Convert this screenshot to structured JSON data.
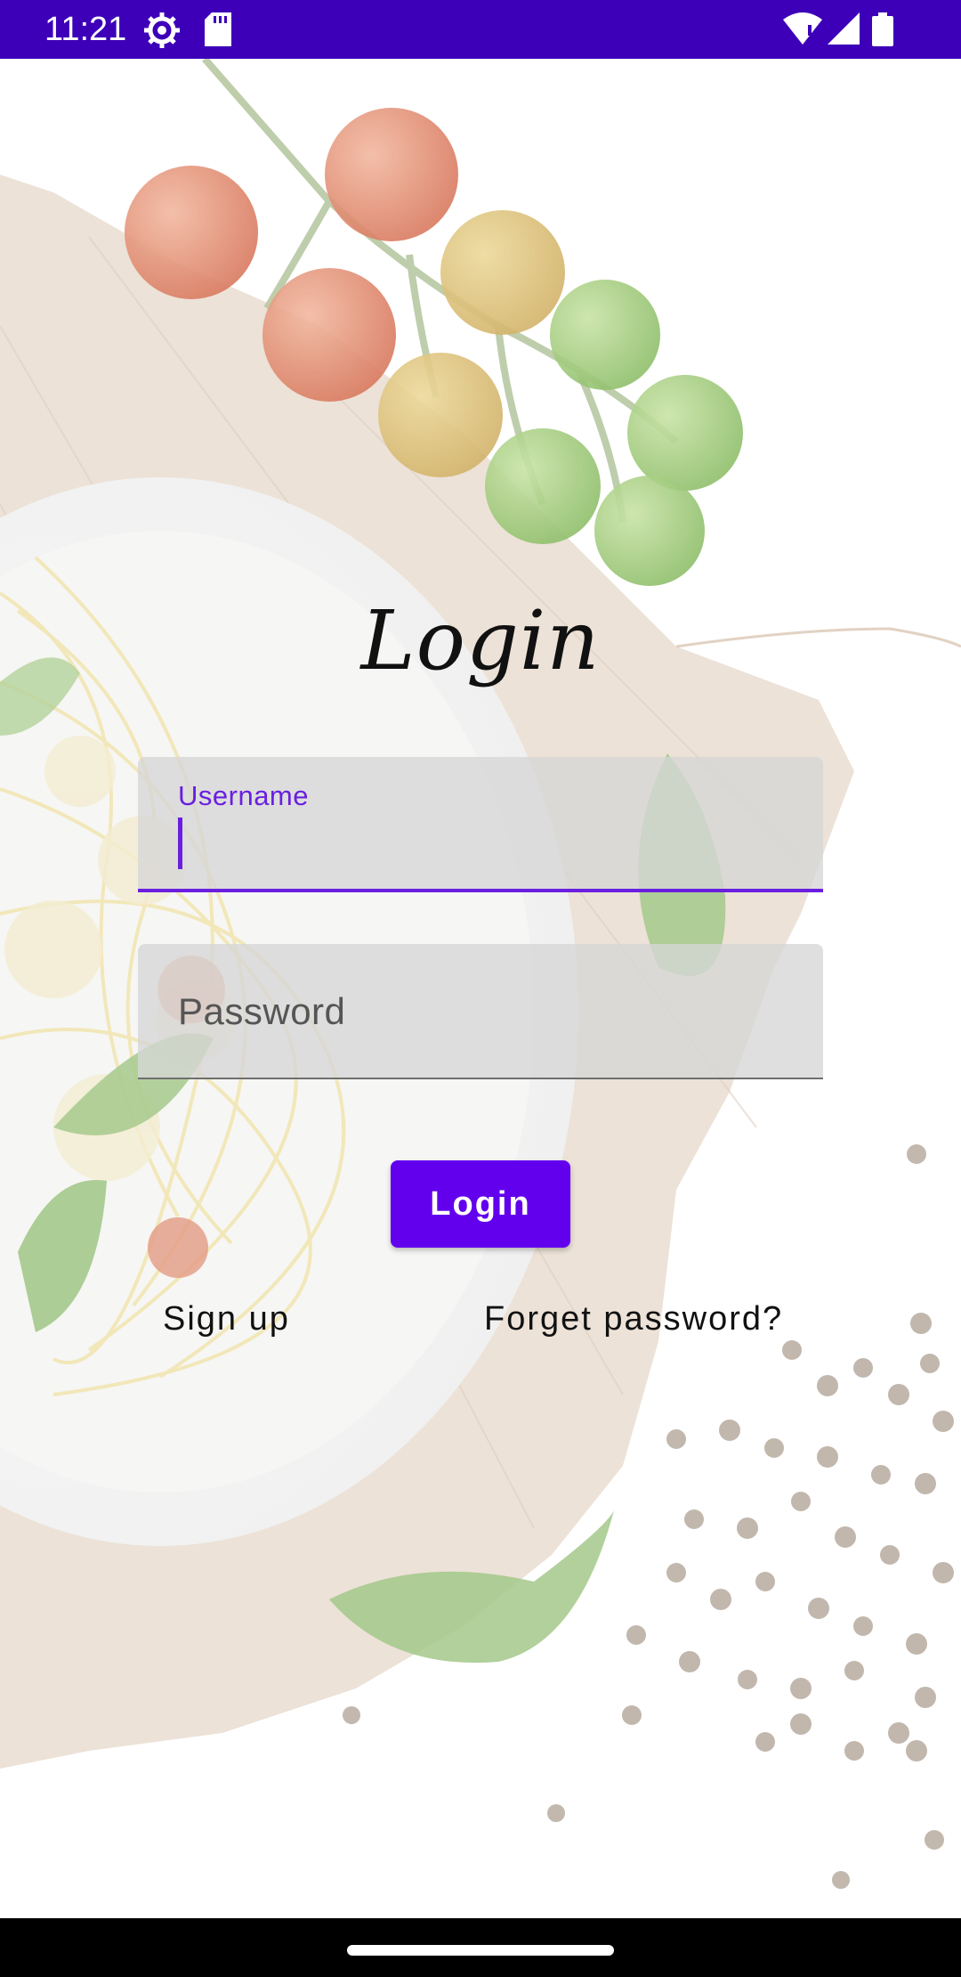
{
  "status_bar": {
    "time": "11:21",
    "icons": [
      "settings-icon",
      "sd-card-icon",
      "wifi-icon",
      "signal-icon",
      "battery-icon"
    ],
    "background_color": "#3d00b8"
  },
  "screen": {
    "title": "Login"
  },
  "form": {
    "username": {
      "label": "Username",
      "value": ""
    },
    "password": {
      "placeholder": "Password",
      "value": ""
    },
    "login_button_label": "Login",
    "signup_link": "Sign up",
    "forget_link": "Forget password?"
  },
  "colors": {
    "accent": "#6200ee",
    "focused_field": "#6a1fe0",
    "field_bg": "#d6d6d6"
  },
  "background_image": {
    "subject": "spaghetti-plate-with-tomatoes-basil-pepper"
  }
}
